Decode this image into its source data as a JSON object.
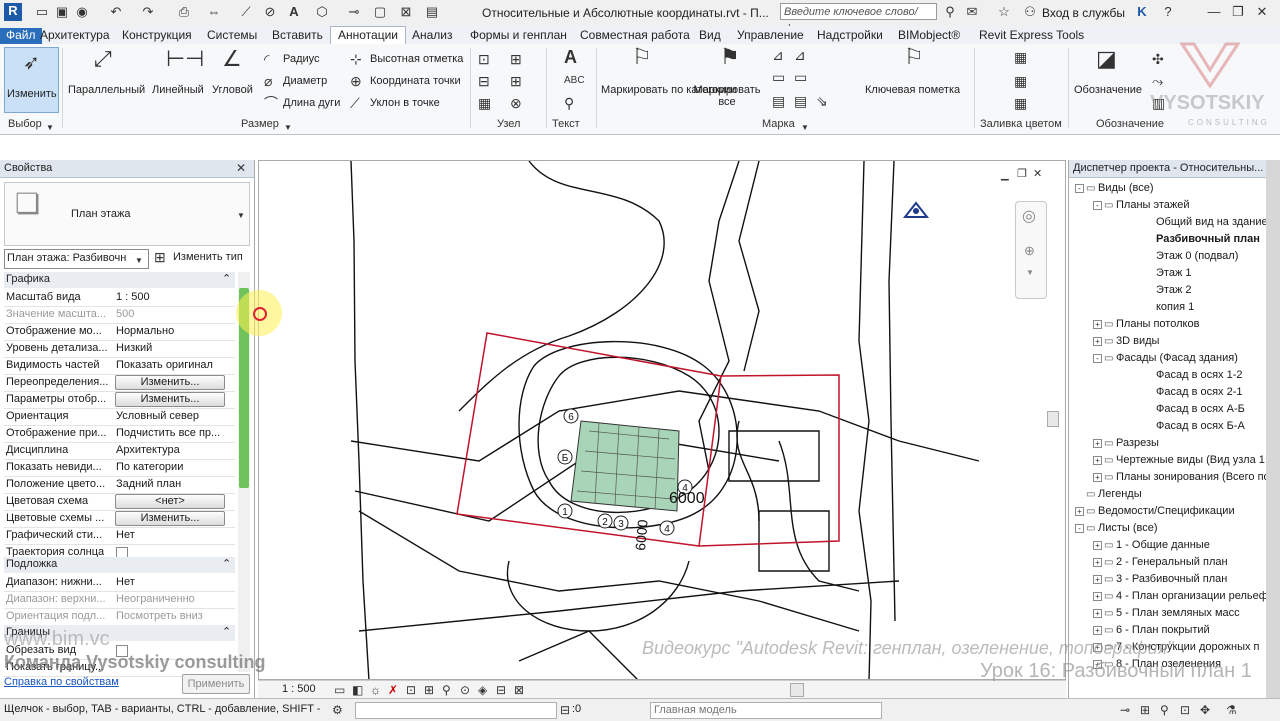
{
  "title_bar": {
    "document_title": "Относительные и Абсолютные координаты.rvt - П...",
    "search_placeholder": "Введите ключевое слово/фразу",
    "sign_in": "Вход в службы",
    "app_letter": "R"
  },
  "tabs": [
    "Файл",
    "Архитектура",
    "Конструкция",
    "Системы",
    "Вставить",
    "Аннотации",
    "Анализ",
    "Формы и генплан",
    "Совместная работа",
    "Вид",
    "Управление",
    "Надстройки",
    "BIMobject®",
    "Revit Express Tools"
  ],
  "active_tab": "Аннотации",
  "ribbon": {
    "modify": "Изменить",
    "select_panel": "Выбор",
    "parallel": "Параллельный",
    "linear": "Линейный",
    "angular": "Угловой",
    "radius": "Радиус",
    "diameter": "Диаметр",
    "arc_length": "Длина дуги",
    "spot_elevation": "Высотная отметка",
    "spot_coordinate": "Координата точки",
    "spot_slope": "Уклон в точке",
    "dimension_panel": "Размер",
    "detail_panel": "Узел",
    "text_panel": "Текст",
    "tag_by_category": "Маркировать по категории",
    "tag_all": "Маркировать все",
    "keynote": "Ключевая пометка",
    "tag_panel": "Марка",
    "color_fill_panel": "Заливка цветом",
    "symbol": "Обозначение",
    "symbol_panel": "Обозначение"
  },
  "properties": {
    "title": "Свойства",
    "type_name": "План этажа",
    "instance_select": "План этажа: Разбивочн",
    "edit_type": "Изменить тип",
    "group_graphics": "Графика",
    "rows": [
      {
        "name": "Масштаб вида",
        "value": "1 : 500"
      },
      {
        "name": "Значение масшта...",
        "value": "500",
        "dim": true
      },
      {
        "name": "Отображение мо...",
        "value": "Нормально"
      },
      {
        "name": "Уровень детализа...",
        "value": "Низкий"
      },
      {
        "name": "Видимость частей",
        "value": "Показать оригинал"
      },
      {
        "name": "Переопределения...",
        "value": "Изменить...",
        "button": true
      },
      {
        "name": "Параметры отобр...",
        "value": "Изменить...",
        "button": true
      },
      {
        "name": "Ориентация",
        "value": "Условный север"
      },
      {
        "name": "Отображение при...",
        "value": "Подчистить все пр..."
      },
      {
        "name": "Дисциплина",
        "value": "Архитектура"
      },
      {
        "name": "Показать невиди...",
        "value": "По категории"
      },
      {
        "name": "Положение цвето...",
        "value": "Задний план"
      },
      {
        "name": "Цветовая схема",
        "value": "<нет>",
        "button": true
      },
      {
        "name": "Цветовые схемы ...",
        "value": "Изменить...",
        "button": true
      },
      {
        "name": "Графический сти...",
        "value": "Нет"
      },
      {
        "name": "Траектория солнца",
        "value": "",
        "checkbox": true
      }
    ],
    "group_underlay": "Подложка",
    "underlay_rows": [
      {
        "name": "Диапазон: нижни...",
        "value": "Нет"
      },
      {
        "name": "Диапазон: верхни...",
        "value": "Неограниченно",
        "dim": true
      },
      {
        "name": "Ориентация подл...",
        "value": "Посмотреть вниз",
        "dim": true
      }
    ],
    "group_extents": "Границы",
    "extents_rows": [
      {
        "name": "Обрезать вид",
        "value": "",
        "checkbox": true
      },
      {
        "name": "Показать границу...",
        "value": ""
      }
    ],
    "help_link": "Справка по свойствам",
    "apply": "Применить"
  },
  "canvas": {
    "dimension_label": "6000",
    "dimension_label_vertical": "6000",
    "grid_bubbles": [
      "6",
      "Б",
      "1",
      "2",
      "3",
      "4",
      "4"
    ]
  },
  "view_control": {
    "scale": "1 : 500"
  },
  "project_browser": {
    "title": "Диспетчер проекта - Относительны...",
    "items": [
      {
        "label": "Виды (все)",
        "level": 0,
        "toggle": "-"
      },
      {
        "label": "Планы этажей",
        "level": 1,
        "toggle": "-"
      },
      {
        "label": "Общий вид на здание",
        "level": 2
      },
      {
        "label": "Разбивочный план",
        "level": 2,
        "bold": true
      },
      {
        "label": "Этаж 0 (подвал)",
        "level": 2
      },
      {
        "label": "Этаж 1",
        "level": 2
      },
      {
        "label": "Этаж 2",
        "level": 2
      },
      {
        "label": "копия 1",
        "level": 2
      },
      {
        "label": "Планы потолков",
        "level": 1,
        "toggle": "+"
      },
      {
        "label": "3D виды",
        "level": 1,
        "toggle": "+"
      },
      {
        "label": "Фасады (Фасад здания)",
        "level": 1,
        "toggle": "-"
      },
      {
        "label": "Фасад в осях 1-2",
        "level": 2
      },
      {
        "label": "Фасад в осях 2-1",
        "level": 2
      },
      {
        "label": "Фасад в осях А-Б",
        "level": 2
      },
      {
        "label": "Фасад в осях Б-А",
        "level": 2
      },
      {
        "label": "Разрезы",
        "level": 1,
        "toggle": "+"
      },
      {
        "label": "Чертежные виды (Вид узла 1",
        "level": 1,
        "toggle": "+"
      },
      {
        "label": "Планы зонирования (Всего по",
        "level": 1,
        "toggle": "+"
      },
      {
        "label": "Легенды",
        "level": 0
      },
      {
        "label": "Ведомости/Спецификации",
        "level": 0,
        "toggle": "+"
      },
      {
        "label": "Листы (все)",
        "level": 0,
        "toggle": "-"
      },
      {
        "label": "1 - Общие данные",
        "level": 1,
        "toggle": "+"
      },
      {
        "label": "2 - Генеральный план",
        "level": 1,
        "toggle": "+"
      },
      {
        "label": "3 - Разбивочный план",
        "level": 1,
        "toggle": "+"
      },
      {
        "label": "4 - План организации рельеф",
        "level": 1,
        "toggle": "+"
      },
      {
        "label": "5 - План земляных масс",
        "level": 1,
        "toggle": "+"
      },
      {
        "label": "6 - План покрытий",
        "level": 1,
        "toggle": "+"
      },
      {
        "label": "7 - Конструкции дорожных п",
        "level": 1,
        "toggle": "+"
      },
      {
        "label": "8 - План озеленения",
        "level": 1,
        "toggle": "+"
      }
    ]
  },
  "status_bar": {
    "hint": "Щелчок - выбор, TAB - варианты, CTRL - добавление, SHIFT - ",
    "count": ":0",
    "model": "Главная модель"
  },
  "watermark": {
    "site": "www.bim.vc",
    "team": "Команда Vysotskiy consulting",
    "course": "Видеокурс \"Autodesk Revit: генплан, озеленение, топография\"",
    "lesson": "Урок 16: Разбивочный план 1",
    "logo": "VYSOTSKIY",
    "logo_sub": "CONSULTING"
  }
}
